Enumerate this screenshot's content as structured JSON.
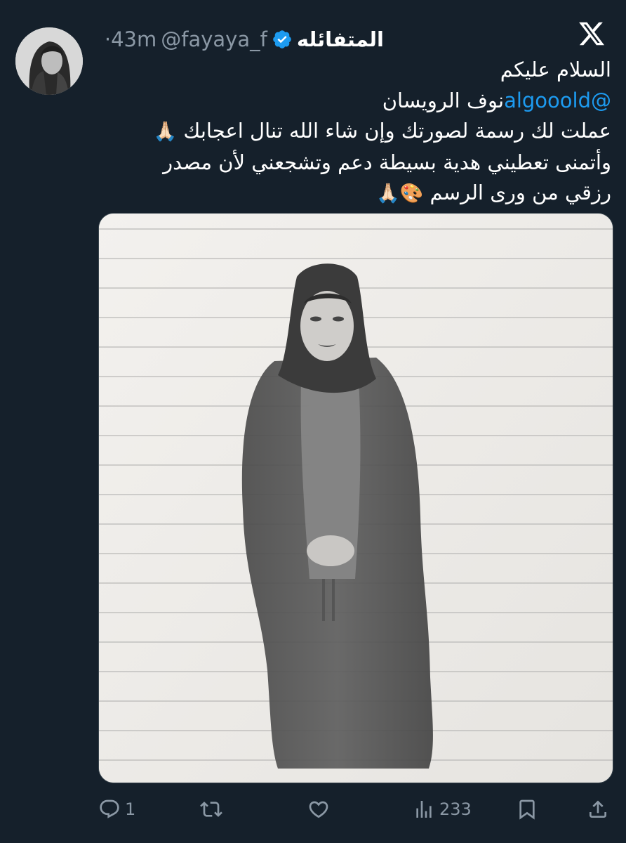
{
  "tweet": {
    "display_name": "المتفائله",
    "handle": "@fayaya_f",
    "separator": "·",
    "time": "43m",
    "text": {
      "line1": "السلام عليكم",
      "line2_mention": "@algooold",
      "line2_name": "نوف الرويسان",
      "line3": "عملت لك رسمة لصورتك وإن شاء الله  تنال اعجابك",
      "line3_emoji": "🙏🏻",
      "line4": "وأتمنى تعطيني هدية بسيطة دعم  وتشجعني لأن مصدر",
      "line5": "رزقي من ورى الرسم",
      "line5_emoji": "🎨🙏🏻"
    }
  },
  "actions": {
    "replies": "1",
    "likes": "",
    "views": "233"
  },
  "icons": {
    "logo": "x-logo-icon",
    "verified": "verified-badge-icon",
    "reply": "reply-icon",
    "retweet": "retweet-icon",
    "like": "heart-icon",
    "views": "views-icon",
    "bookmark": "bookmark-icon",
    "share": "share-icon"
  },
  "colors": {
    "background": "#15202b",
    "accent": "#1d9bf0",
    "muted": "#8b98a5"
  }
}
